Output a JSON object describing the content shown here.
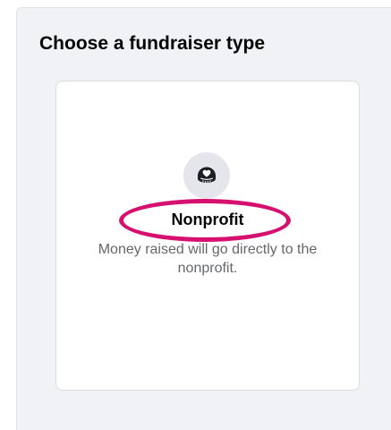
{
  "section": {
    "title": "Choose a fundraiser type"
  },
  "option": {
    "icon": "donation-heart-icon",
    "title": "Nonprofit",
    "description": "Money raised will go directly to the nonprofit."
  },
  "annotation": {
    "highlight_color": "#d6106f"
  }
}
